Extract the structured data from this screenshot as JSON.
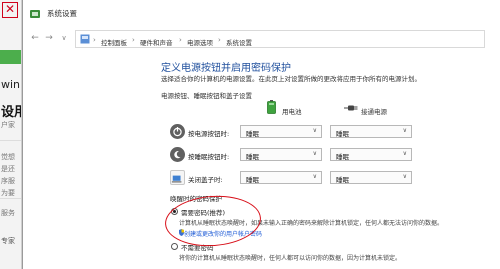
{
  "background_page": {
    "line1": "win1",
    "line2": "设用",
    "small_text": [
      "户家",
      "觉想",
      "是还",
      "序服",
      "为要",
      "服务"
    ],
    "line4": "专家"
  },
  "window": {
    "title": "系统设置"
  },
  "address_bar": {
    "back": "←",
    "forward": "→",
    "up": "↑",
    "breadcrumbs": [
      "控制面板",
      "硬件和声音",
      "电源选项",
      "系统设置"
    ],
    "separator": "›",
    "dropdown_arrow": "∨"
  },
  "main": {
    "heading": "定义电源按钮并启用密码保护",
    "subtext": "选择适合你的计算机的电源设置。在此页上对设置所做的更改将应用于你所有的电源计划。",
    "section_title": "电源按钮、睡眠按钮和盖子设置",
    "columns": {
      "battery": "用电池",
      "plugged": "接通电源"
    },
    "rows": [
      {
        "label": "按电源按钮时:",
        "icon": "power-icon",
        "battery": "睡眠",
        "plugged": "睡眠"
      },
      {
        "label": "按睡眠按钮时:",
        "icon": "sleep-icon",
        "battery": "睡眠",
        "plugged": "睡眠"
      },
      {
        "label": "关闭盖子时:",
        "icon": "lid-icon",
        "battery": "睡眠",
        "plugged": "睡眠"
      }
    ],
    "dropdown_arrow": "∨"
  },
  "password": {
    "title": "唤醒时的密码保护",
    "option_required": {
      "label": "需要密码(推荐)",
      "desc": "计算机从睡眠状态唤醒时，如果未输入正确的密码来解除计算机锁定，任何人都无法访问你的数据。",
      "link": "创建或更改你的用户帐户密码",
      "selected": true
    },
    "option_not_required": {
      "label": "不需要密码",
      "desc": "将你的计算机从睡眠状态唤醒时，任何人都可以访问你的数据，因为计算机未锁定。",
      "selected": false
    }
  },
  "colors": {
    "heading": "#1e4e9c",
    "link": "#1e5bd6",
    "annotation": "#d8101a"
  }
}
